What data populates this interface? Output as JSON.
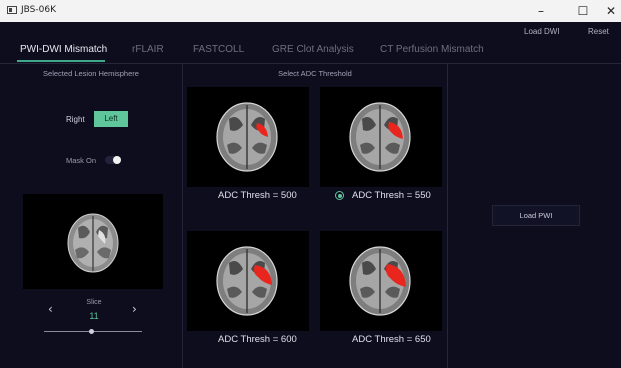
{
  "window": {
    "title": "JBS-06K",
    "controls": [
      "–",
      "☐",
      "✕"
    ]
  },
  "header": {
    "load_dwi": "Load DWI",
    "reset": "Reset"
  },
  "tabs": [
    {
      "label": "PWI-DWI Mismatch",
      "active": true
    },
    {
      "label": "rFLAIR",
      "active": false
    },
    {
      "label": "FASTCOLL",
      "active": false
    },
    {
      "label": "GRE Clot Analysis",
      "active": false
    },
    {
      "label": "CT Perfusion Mismatch",
      "active": false
    }
  ],
  "left_panel": {
    "title": "Selected Lesion Hemisphere",
    "hemisphere_right": "Right",
    "hemisphere_left": "Left",
    "selected_hemisphere": "Left",
    "mask_label": "Mask On",
    "mask_on": true,
    "slice_label": "Slice",
    "slice_value": "11",
    "prev_arrow": "‹",
    "next_arrow": "›",
    "slice_position": 0.48
  },
  "center_panel": {
    "title": "Select ADC Threshold",
    "thresholds": [
      {
        "label": "ADC Thresh = 500",
        "selected": false
      },
      {
        "label": "ADC Thresh = 550",
        "selected": true
      },
      {
        "label": "ADC Thresh = 600",
        "selected": false
      },
      {
        "label": "ADC Thresh = 650",
        "selected": false
      }
    ]
  },
  "right_panel": {
    "load_pwi": "Load PWI"
  },
  "colors": {
    "accent": "#5fc59a",
    "background": "#0d0d1e",
    "lesion": "#e8261e"
  }
}
